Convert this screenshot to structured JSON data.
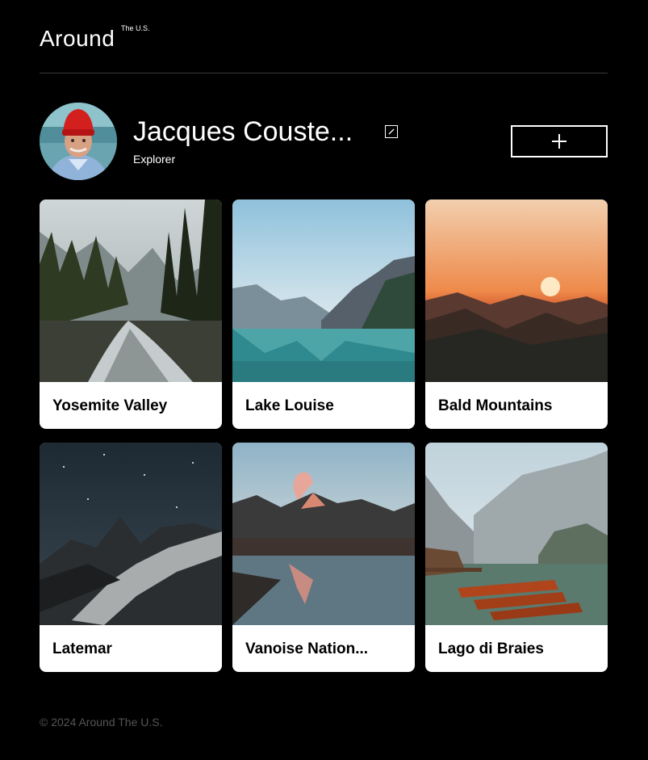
{
  "header": {
    "logo": "Around",
    "logo_sup": "The U.S."
  },
  "profile": {
    "name": "Jacques Couste...",
    "role": "Explorer",
    "edit_icon": "pencil-icon",
    "add_icon": "plus-icon"
  },
  "cards": [
    {
      "title": "Yosemite Valley"
    },
    {
      "title": "Lake Louise"
    },
    {
      "title": "Bald Mountains"
    },
    {
      "title": "Latemar"
    },
    {
      "title": "Vanoise Nation..."
    },
    {
      "title": "Lago di Braies"
    }
  ],
  "footer": {
    "text": "© 2024 Around The U.S."
  }
}
